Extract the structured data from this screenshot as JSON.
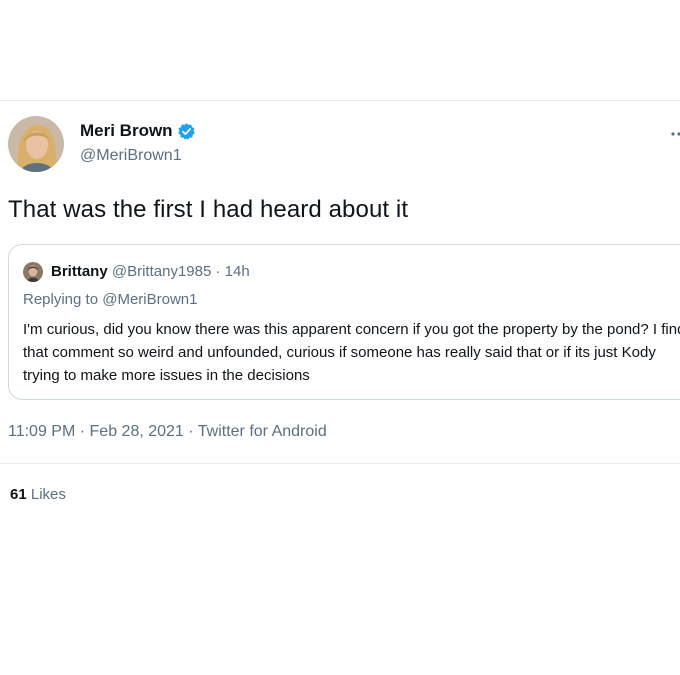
{
  "tweet": {
    "author_name": "Meri Brown",
    "author_handle": "@MeriBrown1",
    "text": "That was the first I had heard about it",
    "timestamp": "11:09 PM",
    "date": "Feb 28, 2021",
    "source": "Twitter for Android",
    "likes_count": "61",
    "likes_label": "Likes"
  },
  "quote": {
    "author_name": "Brittany",
    "author_handle": "@Brittany1985",
    "time_ago": "14h",
    "replying_label": "Replying to",
    "replying_handle": "@MeriBrown1",
    "text": "I'm curious, did you know there was this apparent concern if you got the property by the pond? I find that comment so weird and unfounded, curious if someone has really said that or if its just Kody trying to make more issues in the decisions"
  },
  "icons": {
    "verified": "verified-badge-icon",
    "more": "more-options-icon"
  },
  "colors": {
    "verified_blue": "#1da1f2",
    "secondary_text": "#5b7083",
    "border": "#cfd9de"
  }
}
